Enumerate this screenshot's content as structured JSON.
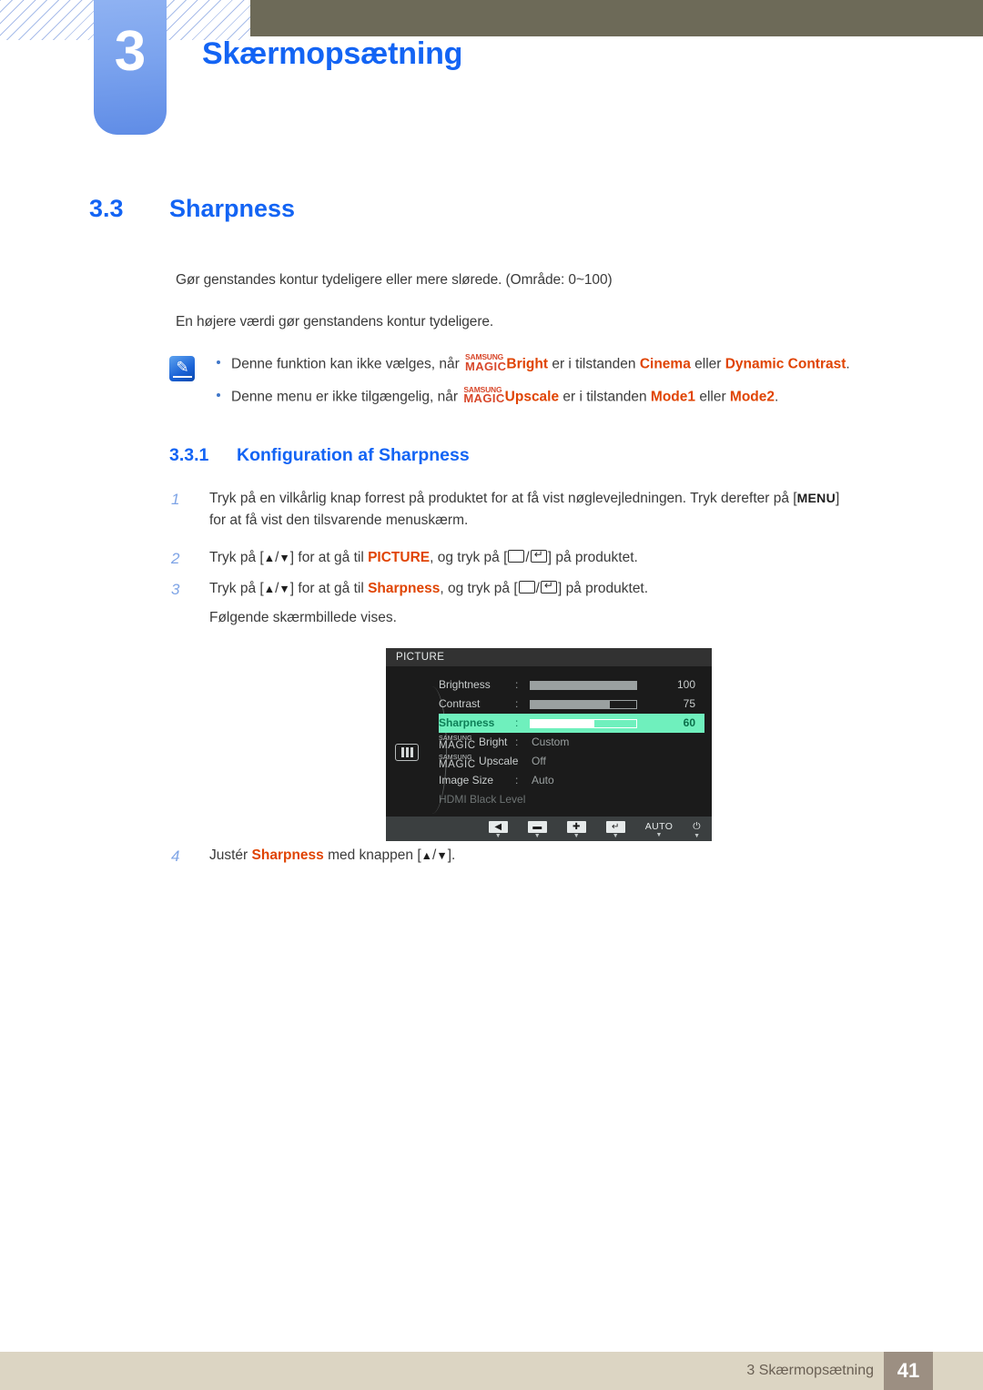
{
  "header": {
    "chapter_number": "3",
    "chapter_title": "Skærmopsætning"
  },
  "section": {
    "number": "3.3",
    "title": "Sharpness",
    "paragraphs": [
      "Gør genstandes kontur tydeligere eller mere slørede. (Område: 0~100)",
      "En højere værdi gør genstandens kontur tydeligere."
    ]
  },
  "note": {
    "icon": "note-pen-icon",
    "items": [
      {
        "pre": "Denne funktion kan ikke vælges, når ",
        "brand_top": "SAMSUNG",
        "brand_bottom": "MAGIC",
        "feature": "Bright",
        "mid": " er i tilstanden ",
        "value1": "Cinema",
        "conj": " eller ",
        "value2": "Dynamic Contrast",
        "post": "."
      },
      {
        "pre": "Denne menu er ikke tilgængelig, når ",
        "brand_top": "SAMSUNG",
        "brand_bottom": "MAGIC",
        "feature": "Upscale",
        "mid": " er i tilstanden ",
        "value1": "Mode1",
        "conj": " eller ",
        "value2": "Mode2",
        "post": "."
      }
    ]
  },
  "subsection": {
    "number": "3.3.1",
    "title": "Konfiguration af Sharpness"
  },
  "steps": {
    "s1": {
      "index": "1",
      "text_before": "Tryk på en vilkårlig knap forrest på produktet for at få vist nøglevejledningen. Tryk derefter på [",
      "key": "MENU",
      "text_after": "]",
      "line2": "for at få vist den tilsvarende menuskærm."
    },
    "s2": {
      "index": "2",
      "t1": "Tryk på [",
      "up": "▲",
      "slash": "/",
      "down": "▼",
      "t2": "] for at gå til ",
      "target": "PICTURE",
      "t3": ", og tryk på [",
      "t4": "] på produktet."
    },
    "s3": {
      "index": "3",
      "t1": "Tryk på [",
      "up": "▲",
      "slash": "/",
      "down": "▼",
      "t2": "] for at gå til ",
      "target": "Sharpness",
      "t3": ", og tryk på [",
      "t4": "] på produktet.",
      "followup": "Følgende skærmbillede vises."
    },
    "s4": {
      "index": "4",
      "t1": "Justér ",
      "target": "Sharpness",
      "t2": " med knappen [",
      "up": "▲",
      "slash": "/",
      "down": "▼",
      "t3": "]."
    }
  },
  "osd": {
    "title": "PICTURE",
    "side_icon": "picture-bars-icon",
    "rows": [
      {
        "label": "Brightness",
        "colon": ":",
        "type": "slider",
        "fill_pct": 100,
        "value": "100"
      },
      {
        "label": "Contrast",
        "colon": ":",
        "type": "slider",
        "fill_pct": 75,
        "value": "75"
      },
      {
        "label": "Sharpness",
        "colon": ":",
        "type": "slider",
        "fill_pct": 60,
        "value": "60",
        "selected": true
      },
      {
        "label_top": "SAMSUNG",
        "label_bottom": "MAGIC",
        "label_suffix": "Bright",
        "colon": ":",
        "type": "text",
        "value": "Custom"
      },
      {
        "label_top": "SAMSUNG",
        "label_bottom": "MAGIC",
        "label_suffix": "Upscale",
        "colon": ":",
        "type": "text",
        "value": "Off"
      },
      {
        "label": "Image Size",
        "colon": ":",
        "type": "text",
        "value": "Auto"
      },
      {
        "label": "HDMI Black Level",
        "type": "text",
        "value": "",
        "dim": true
      }
    ],
    "scroll_caret": "▼",
    "footer_buttons": [
      {
        "name": "back",
        "icon": "◀",
        "caret": "▼"
      },
      {
        "name": "minus",
        "icon": "▬",
        "caret": "▼"
      },
      {
        "name": "plus",
        "icon": "✚",
        "caret": "▼"
      },
      {
        "name": "enter",
        "icon": "↵",
        "caret": "▼"
      },
      {
        "name": "auto",
        "text": "AUTO",
        "caret": "▼"
      },
      {
        "name": "power",
        "text": "⏻",
        "caret": "▼"
      }
    ]
  },
  "footer": {
    "text": "3 Skærmopsætning",
    "page": "41"
  },
  "colors": {
    "accent_blue": "#1364f4",
    "orange": "#e04403",
    "topbar": "#6d6a58",
    "footer_bg": "#dcd5c3",
    "page_badge": "#9c8f82",
    "osd_highlight": "#6ff0bd"
  }
}
